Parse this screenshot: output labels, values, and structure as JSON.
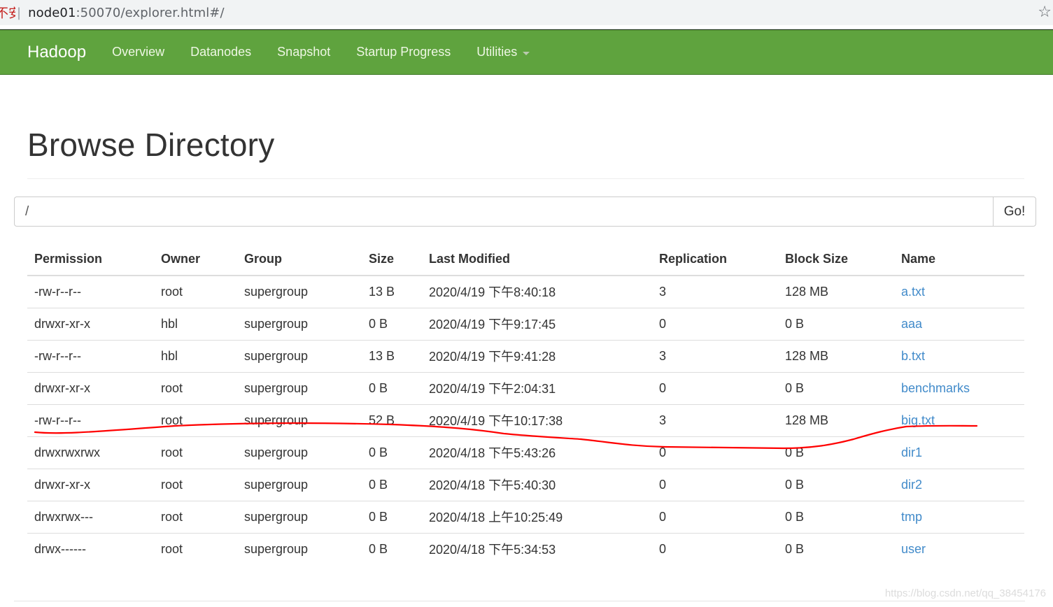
{
  "browser": {
    "security_label": "不安全",
    "url_host": "node01",
    "url_rest": ":50070/explorer.html#/",
    "bookmark_icon": "star-icon"
  },
  "navbar": {
    "brand": "Hadoop",
    "items": [
      {
        "label": "Overview"
      },
      {
        "label": "Datanodes"
      },
      {
        "label": "Snapshot"
      },
      {
        "label": "Startup Progress"
      },
      {
        "label": "Utilities",
        "dropdown": true
      }
    ],
    "color": "#5fa33e"
  },
  "page": {
    "title": "Browse Directory"
  },
  "path_bar": {
    "value": "/",
    "go_label": "Go!"
  },
  "table": {
    "columns": [
      "Permission",
      "Owner",
      "Group",
      "Size",
      "Last Modified",
      "Replication",
      "Block Size",
      "Name"
    ],
    "rows": [
      {
        "permission": "-rw-r--r--",
        "owner": "root",
        "group": "supergroup",
        "size": "13 B",
        "modified": "2020/4/19 下午8:40:18",
        "replication": "3",
        "block_size": "128 MB",
        "name": "a.txt"
      },
      {
        "permission": "drwxr-xr-x",
        "owner": "hbl",
        "group": "supergroup",
        "size": "0 B",
        "modified": "2020/4/19 下午9:17:45",
        "replication": "0",
        "block_size": "0 B",
        "name": "aaa"
      },
      {
        "permission": "-rw-r--r--",
        "owner": "hbl",
        "group": "supergroup",
        "size": "13 B",
        "modified": "2020/4/19 下午9:41:28",
        "replication": "3",
        "block_size": "128 MB",
        "name": "b.txt"
      },
      {
        "permission": "drwxr-xr-x",
        "owner": "root",
        "group": "supergroup",
        "size": "0 B",
        "modified": "2020/4/19 下午2:04:31",
        "replication": "0",
        "block_size": "0 B",
        "name": "benchmarks"
      },
      {
        "permission": "-rw-r--r--",
        "owner": "root",
        "group": "supergroup",
        "size": "52 B",
        "modified": "2020/4/19 下午10:17:38",
        "replication": "3",
        "block_size": "128 MB",
        "name": "big.txt"
      },
      {
        "permission": "drwxrwxrwx",
        "owner": "root",
        "group": "supergroup",
        "size": "0 B",
        "modified": "2020/4/18 下午5:43:26",
        "replication": "0",
        "block_size": "0 B",
        "name": "dir1"
      },
      {
        "permission": "drwxr-xr-x",
        "owner": "root",
        "group": "supergroup",
        "size": "0 B",
        "modified": "2020/4/18 下午5:40:30",
        "replication": "0",
        "block_size": "0 B",
        "name": "dir2"
      },
      {
        "permission": "drwxrwx---",
        "owner": "root",
        "group": "supergroup",
        "size": "0 B",
        "modified": "2020/4/18 上午10:25:49",
        "replication": "0",
        "block_size": "0 B",
        "name": "tmp"
      },
      {
        "permission": "drwx------",
        "owner": "root",
        "group": "supergroup",
        "size": "0 B",
        "modified": "2020/4/18 下午5:34:53",
        "replication": "0",
        "block_size": "0 B",
        "name": "user"
      }
    ],
    "link_color": "#428bca"
  },
  "annotation": {
    "type": "red hand-drawn underline",
    "target_row": "big.txt",
    "color": "#ff0000"
  },
  "watermark": "https://blog.csdn.net/qq_38454176"
}
